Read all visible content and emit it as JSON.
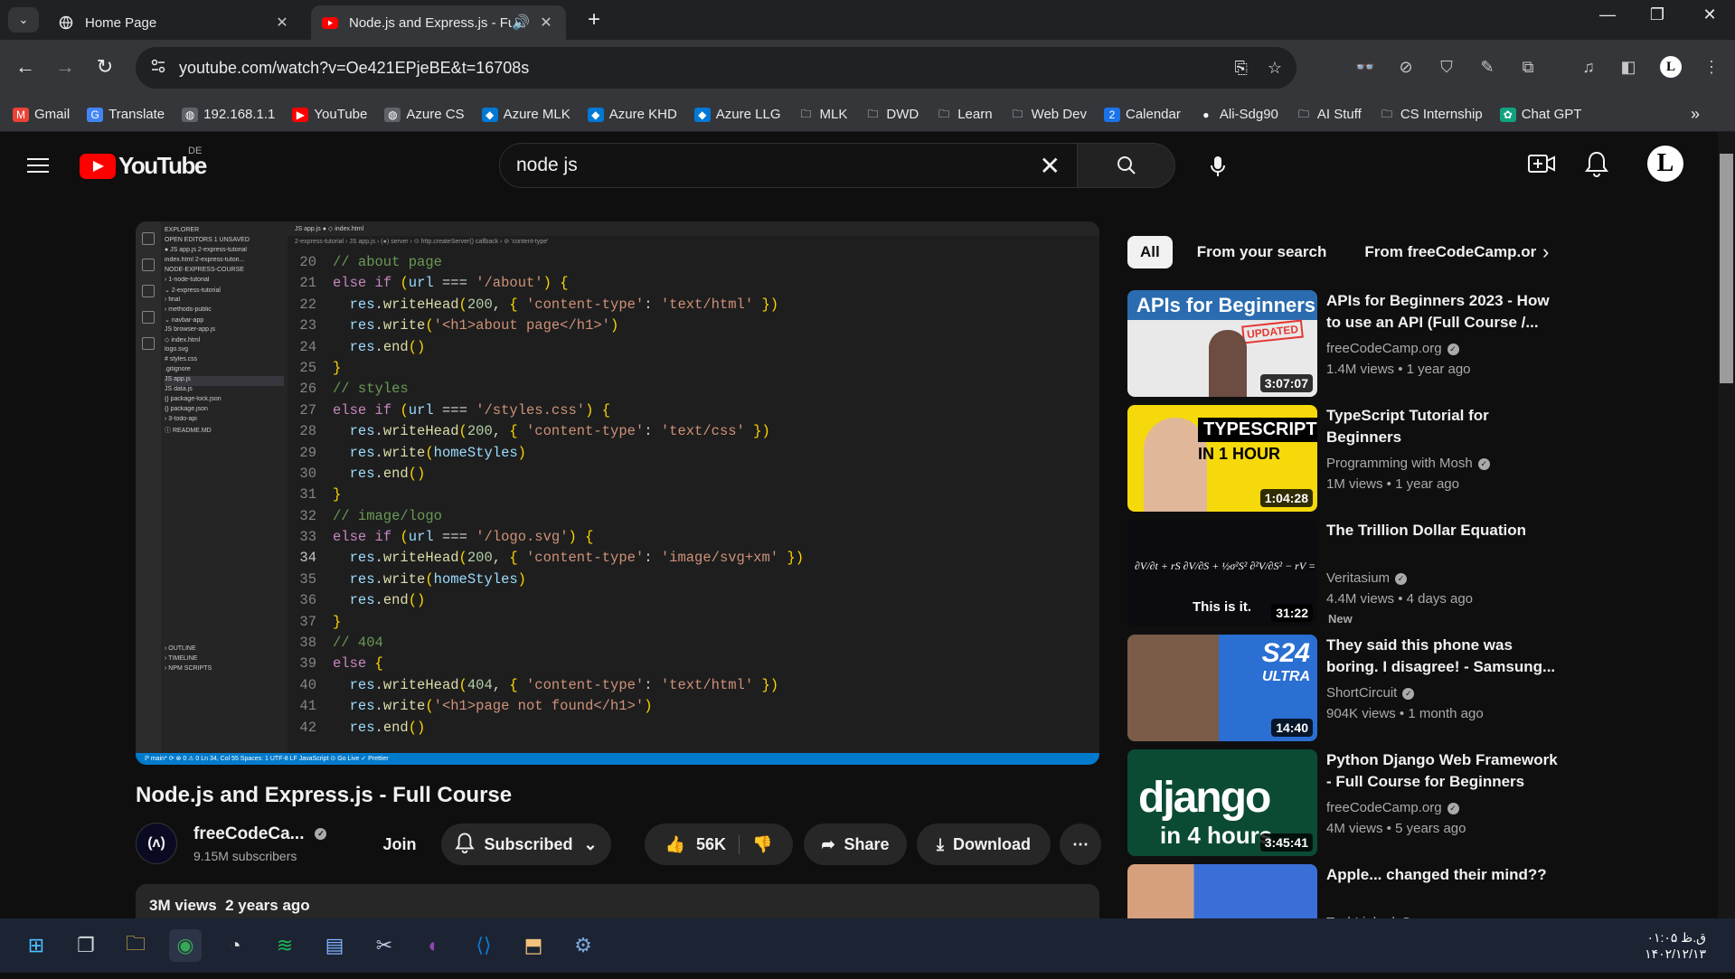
{
  "browser": {
    "tabs": [
      {
        "title": "Home Page",
        "close": "✕"
      },
      {
        "title": "Node.js and Express.js - Full",
        "close": "✕",
        "audio": "🔊"
      }
    ],
    "new_tab": "+",
    "window_controls": [
      "—",
      "❐",
      "✕"
    ],
    "url": "youtube.com/watch?v=Oe421EPjeBE&t=16708s",
    "bookmarks": [
      {
        "label": "Gmail",
        "icon": "gmail-icon",
        "color": "#ea4335",
        "glyph": "M"
      },
      {
        "label": "Translate",
        "icon": "translate-icon",
        "color": "#4285f4",
        "glyph": "G"
      },
      {
        "label": "192.168.1.1",
        "icon": "globe-icon",
        "color": "#5f6368",
        "glyph": "◍"
      },
      {
        "label": "YouTube",
        "icon": "youtube-icon",
        "color": "#ff0000",
        "glyph": "▶"
      },
      {
        "label": "Azure CS",
        "icon": "globe-icon",
        "color": "#5f6368",
        "glyph": "◍"
      },
      {
        "label": "Azure MLK",
        "icon": "azure-icon",
        "color": "#0078d4",
        "glyph": "◆"
      },
      {
        "label": "Azure KHD",
        "icon": "azure-icon",
        "color": "#0078d4",
        "glyph": "◆"
      },
      {
        "label": "Azure LLG",
        "icon": "azure-icon",
        "color": "#0078d4",
        "glyph": "◆"
      },
      {
        "label": "MLK",
        "icon": "folder-icon",
        "color": "#35363a",
        "glyph": "🗀"
      },
      {
        "label": "DWD",
        "icon": "folder-icon",
        "color": "#35363a",
        "glyph": "🗀"
      },
      {
        "label": "Learn",
        "icon": "folder-icon",
        "color": "#35363a",
        "glyph": "🗀"
      },
      {
        "label": "Web Dev",
        "icon": "folder-icon",
        "color": "#35363a",
        "glyph": "🗀"
      },
      {
        "label": "Calendar",
        "icon": "calendar-icon",
        "color": "#1a73e8",
        "glyph": "2"
      },
      {
        "label": "Ali-Sdg90",
        "icon": "github-icon",
        "color": "#35363a",
        "glyph": "●"
      },
      {
        "label": "AI Stuff",
        "icon": "folder-icon",
        "color": "#35363a",
        "glyph": "🗀"
      },
      {
        "label": "CS Internship",
        "icon": "folder-icon",
        "color": "#35363a",
        "glyph": "🗀"
      },
      {
        "label": "Chat GPT",
        "icon": "chatgpt-icon",
        "color": "#10a37f",
        "glyph": "✿"
      }
    ],
    "more_bookmarks": "»"
  },
  "youtube": {
    "logo_word": "YouTube",
    "country_code": "DE",
    "search_value": "node js",
    "avatar_letter": "L"
  },
  "editor": {
    "explorer_lines": [
      "EXPLORER",
      "OPEN EDITORS  1 UNSAVED",
      "● JS app.js  2-express-tutorial",
      "  index.html  2-express-tutori...",
      "NODE-EXPRESS-COURSE",
      "› 1-node-tutorial",
      "⌄ 2-express-tutorial",
      "  › final",
      "  › methods-public",
      "  ⌄ navbar-app",
      "     JS browser-app.js",
      "     ◇ index.html",
      "     logo.svg",
      "     # styles.css",
      "  .gitignore",
      "  JS app.js",
      "  JS data.js",
      "  {} package-lock.json",
      "  {} package.json",
      "› 3-todo-api",
      "ⓘ README.MD"
    ],
    "bottom_sections": [
      "› OUTLINE",
      "› TIMELINE",
      "› NPM SCRIPTS"
    ],
    "tabs": "JS app.js  ●     ◇ index.html",
    "breadcrumb": "2-express-tutorial › JS app.js › (●) server › ⊙ http.createServer() callback › ⊘ 'content-type'",
    "status": "ℙ main*  ⟳  ⊗ 0 ⚠ 0            Ln 34, Col 55   Spaces: 1   UTF-8   LF   JavaScript   ⊙ Go Live   ✓ Prettier",
    "lines": [
      {
        "n": "20",
        "t": "// about page"
      },
      {
        "n": "21",
        "t": "else if (url === '/about') {"
      },
      {
        "n": "22",
        "t": "  res.writeHead(200, { 'content-type': 'text/html' })"
      },
      {
        "n": "23",
        "t": "  res.write('<h1>about page</h1>')"
      },
      {
        "n": "24",
        "t": "  res.end()"
      },
      {
        "n": "25",
        "t": "}"
      },
      {
        "n": "26",
        "t": "// styles"
      },
      {
        "n": "27",
        "t": "else if (url === '/styles.css') {"
      },
      {
        "n": "28",
        "t": "  res.writeHead(200, { 'content-type': 'text/css' })"
      },
      {
        "n": "29",
        "t": "  res.write(homeStyles)"
      },
      {
        "n": "30",
        "t": "  res.end()"
      },
      {
        "n": "31",
        "t": "}"
      },
      {
        "n": "32",
        "t": "// image/logo"
      },
      {
        "n": "33",
        "t": "else if (url === '/logo.svg') {"
      },
      {
        "n": "34",
        "t": "  res.writeHead(200, { 'content-type': 'image/svg+xm' })"
      },
      {
        "n": "35",
        "t": "  res.write(homeStyles)"
      },
      {
        "n": "36",
        "t": "  res.end()"
      },
      {
        "n": "37",
        "t": "}"
      },
      {
        "n": "38",
        "t": "// 404"
      },
      {
        "n": "39",
        "t": "else {"
      },
      {
        "n": "40",
        "t": "  res.writeHead(404, { 'content-type': 'text/html' })"
      },
      {
        "n": "41",
        "t": "  res.write('<h1>page not found</h1>')"
      },
      {
        "n": "42",
        "t": "  res.end()"
      }
    ],
    "current_line": "34"
  },
  "video": {
    "title": "Node.js and Express.js - Full Course",
    "channel": "freeCodeCa...",
    "channel_logo": "(ʌ)",
    "subscribers": "9.15M subscribers",
    "join": "Join",
    "subscribed": "Subscribed",
    "likes": "56K",
    "share": "Share",
    "download": "Download",
    "more": "⋯",
    "views": "3M views",
    "age": "2 years ago"
  },
  "chips": [
    "All",
    "From your search",
    "From freeCodeCamp.or"
  ],
  "recommendations": [
    {
      "title": "APIs for Beginners 2023 - How to use an API (Full Course /...",
      "channel": "freeCodeCamp.org",
      "verified": true,
      "views": "1.4M views",
      "age": "1 year ago",
      "duration": "3:07:07",
      "thumb_text": "APIs for Beginners",
      "thumb_sub": "UPDATED",
      "thumb_bg": "#e9e9e9",
      "thumb_fg": "#ffffff",
      "badge": ""
    },
    {
      "title": "TypeScript Tutorial for Beginners",
      "channel": "Programming with Mosh",
      "verified": true,
      "views": "1M views",
      "age": "1 year ago",
      "duration": "1:04:28",
      "thumb_text": "TYPESCRIPT",
      "thumb_sub": "IN 1 HOUR",
      "thumb_bg": "#f5d90a",
      "thumb_fg": "#000000",
      "badge": ""
    },
    {
      "title": "The Trillion Dollar Equation",
      "channel": "Veritasium",
      "verified": true,
      "views": "4.4M views",
      "age": "4 days ago",
      "duration": "31:22",
      "thumb_text": "∂V/∂t + rS ∂V/∂S + ½σ²S² ∂²V/∂S² − rV = 0",
      "thumb_sub": "This is it.",
      "thumb_bg": "#0b0b10",
      "thumb_fg": "#ffffff",
      "badge": "New"
    },
    {
      "title": "They said this phone was boring. I disagree! - Samsung...",
      "channel": "ShortCircuit",
      "verified": true,
      "views": "904K views",
      "age": "1 month ago",
      "duration": "14:40",
      "thumb_text": "S24",
      "thumb_sub": "ULTRA",
      "thumb_bg": "#2a6fd1",
      "thumb_fg": "#ffffff",
      "badge": ""
    },
    {
      "title": "Python Django Web Framework - Full Course for Beginners",
      "channel": "freeCodeCamp.org",
      "verified": true,
      "views": "4M views",
      "age": "5 years ago",
      "duration": "3:45:41",
      "thumb_text": "django",
      "thumb_sub": "in 4 hours",
      "thumb_bg": "#0c4b33",
      "thumb_fg": "#ffffff",
      "badge": ""
    },
    {
      "title": "Apple... changed their mind??",
      "channel": "TechLinked",
      "verified": true,
      "views": "",
      "age": "",
      "duration": "",
      "thumb_text": "",
      "thumb_sub": "",
      "thumb_bg": "#c0392b",
      "thumb_fg": "#ffffff",
      "badge": ""
    }
  ],
  "taskbar": {
    "apps": [
      {
        "name": "start-icon",
        "color": "#4cc2ff",
        "glyph": "⊞"
      },
      {
        "name": "task-view-icon",
        "color": "#cfd8dc",
        "glyph": "❐"
      },
      {
        "name": "file-explorer-icon",
        "color": "#f7c948",
        "glyph": "🗀"
      },
      {
        "name": "chrome-icon",
        "color": "#34a853",
        "glyph": "◉"
      },
      {
        "name": "speedometer-icon",
        "color": "#e0e0e0",
        "glyph": "◔"
      },
      {
        "name": "spotify-icon",
        "color": "#1db954",
        "glyph": "≋"
      },
      {
        "name": "photos-icon",
        "color": "#7fb3ff",
        "glyph": "▤"
      },
      {
        "name": "snipping-tool-icon",
        "color": "#c5cae9",
        "glyph": "✂"
      },
      {
        "name": "github-desktop-icon",
        "color": "#8e44ad",
        "glyph": "◐"
      },
      {
        "name": "vscode-icon",
        "color": "#0a7bd4",
        "glyph": "⟨⟩"
      },
      {
        "name": "app-installer-icon",
        "color": "#f0c27b",
        "glyph": "⬒"
      },
      {
        "name": "settings-icon",
        "color": "#7aa7d8",
        "glyph": "⚙"
      }
    ],
    "time": "۰۱:۰۵ ق.ظ",
    "date": "۱۴۰۲/۱۲/۱۳"
  }
}
